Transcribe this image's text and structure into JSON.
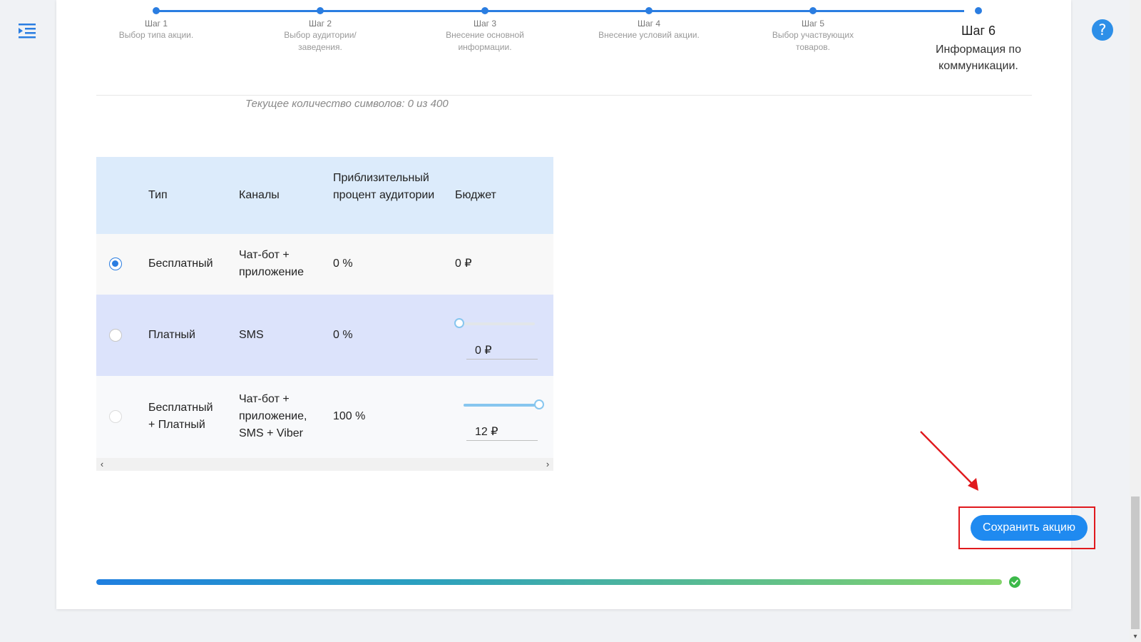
{
  "steps": [
    {
      "num": "Шаг 1",
      "desc": "Выбор типа акции."
    },
    {
      "num": "Шаг 2",
      "desc": "Выбор аудитории/заведения."
    },
    {
      "num": "Шаг 3",
      "desc": "Внесение основной информации."
    },
    {
      "num": "Шаг 4",
      "desc": "Внесение условий акции."
    },
    {
      "num": "Шаг 5",
      "desc": "Выбор участвующих товаров."
    },
    {
      "num": "Шаг 6",
      "desc": "Информация по коммуникации."
    }
  ],
  "char_count_text": "Текущее количество символов: 0 из 400",
  "table": {
    "headers": [
      "Тип",
      "Каналы",
      "Приблизительный процент аудитории",
      "Бюджет"
    ],
    "rows": [
      {
        "type": "Бесплатный",
        "channels": "Чат-бот + приложение",
        "percent": "0 %",
        "budget": "0 ₽",
        "selected": true
      },
      {
        "type": "Платный",
        "channels": "SMS",
        "percent": "0 %",
        "budget": "0 ₽",
        "selected": false,
        "slider_fraction": 0
      },
      {
        "type": "Бесплатный + Платный",
        "channels": "Чат-бот + приложение, SMS + Viber",
        "percent": "100 %",
        "budget": "12 ₽",
        "selected": false,
        "slider_fraction": 1
      }
    ]
  },
  "save_button_label": "Сохранить акцию",
  "progress_fraction": 1,
  "colors": {
    "accent": "#2a7de1",
    "button": "#1f8af0",
    "highlight": "#e0191d",
    "header_bg": "#dcebfb",
    "selected_row_bg": "#dce3fb",
    "success": "#3cb94a"
  },
  "icons": {
    "menu": "menu-collapse-icon",
    "help": "help-icon",
    "check": "check-circle-icon",
    "scroll_left": "chevron-left-icon",
    "scroll_right": "chevron-right-icon"
  }
}
